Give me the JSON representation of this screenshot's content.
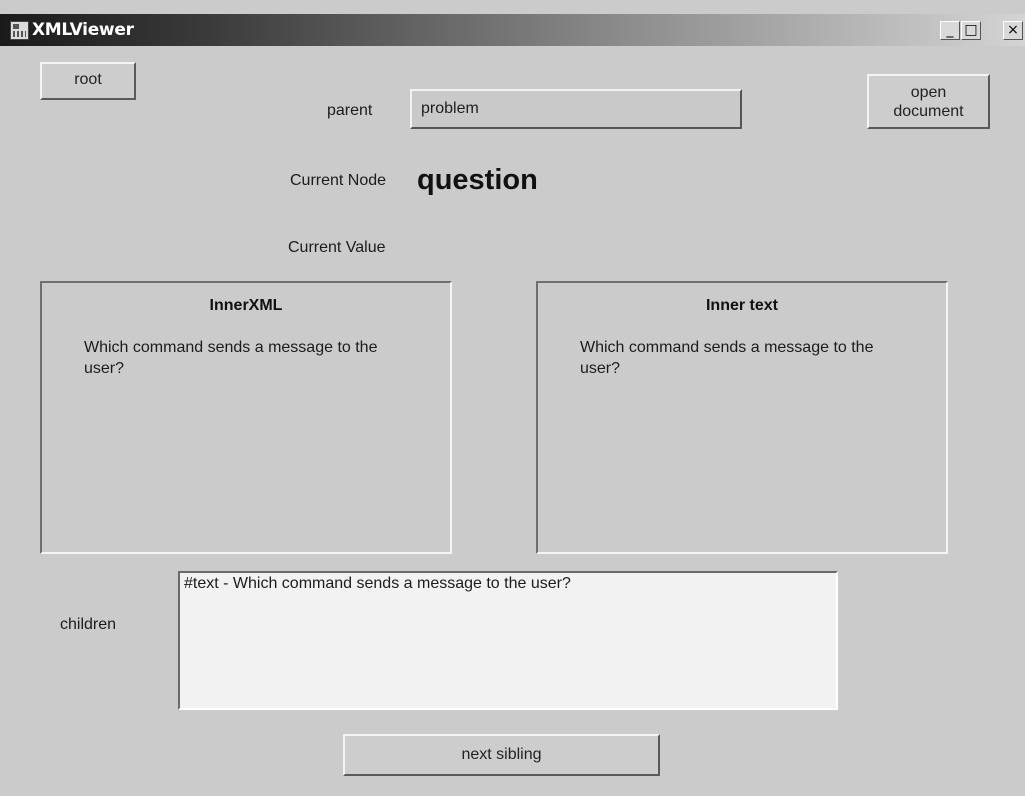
{
  "window": {
    "title": "XMLViewer",
    "controls": {
      "minimize": "_",
      "maximize": "□",
      "close": "×"
    }
  },
  "buttons": {
    "root": "root",
    "open_document": "open\ndocument",
    "next_sibling": "next sibling"
  },
  "fields": {
    "parent_label": "parent",
    "parent_value": "problem",
    "current_node_label": "Current Node",
    "current_node_value": "question",
    "current_value_label": "Current Value",
    "current_value_value": ""
  },
  "panels": {
    "inner_xml": {
      "title": "InnerXML",
      "content": "Which command sends a message to the user?"
    },
    "inner_text": {
      "title": "Inner text",
      "content": "Which command sends a message to the user?"
    }
  },
  "children": {
    "label": "children",
    "items": [
      "#text - Which command sends a message to the user?"
    ]
  }
}
